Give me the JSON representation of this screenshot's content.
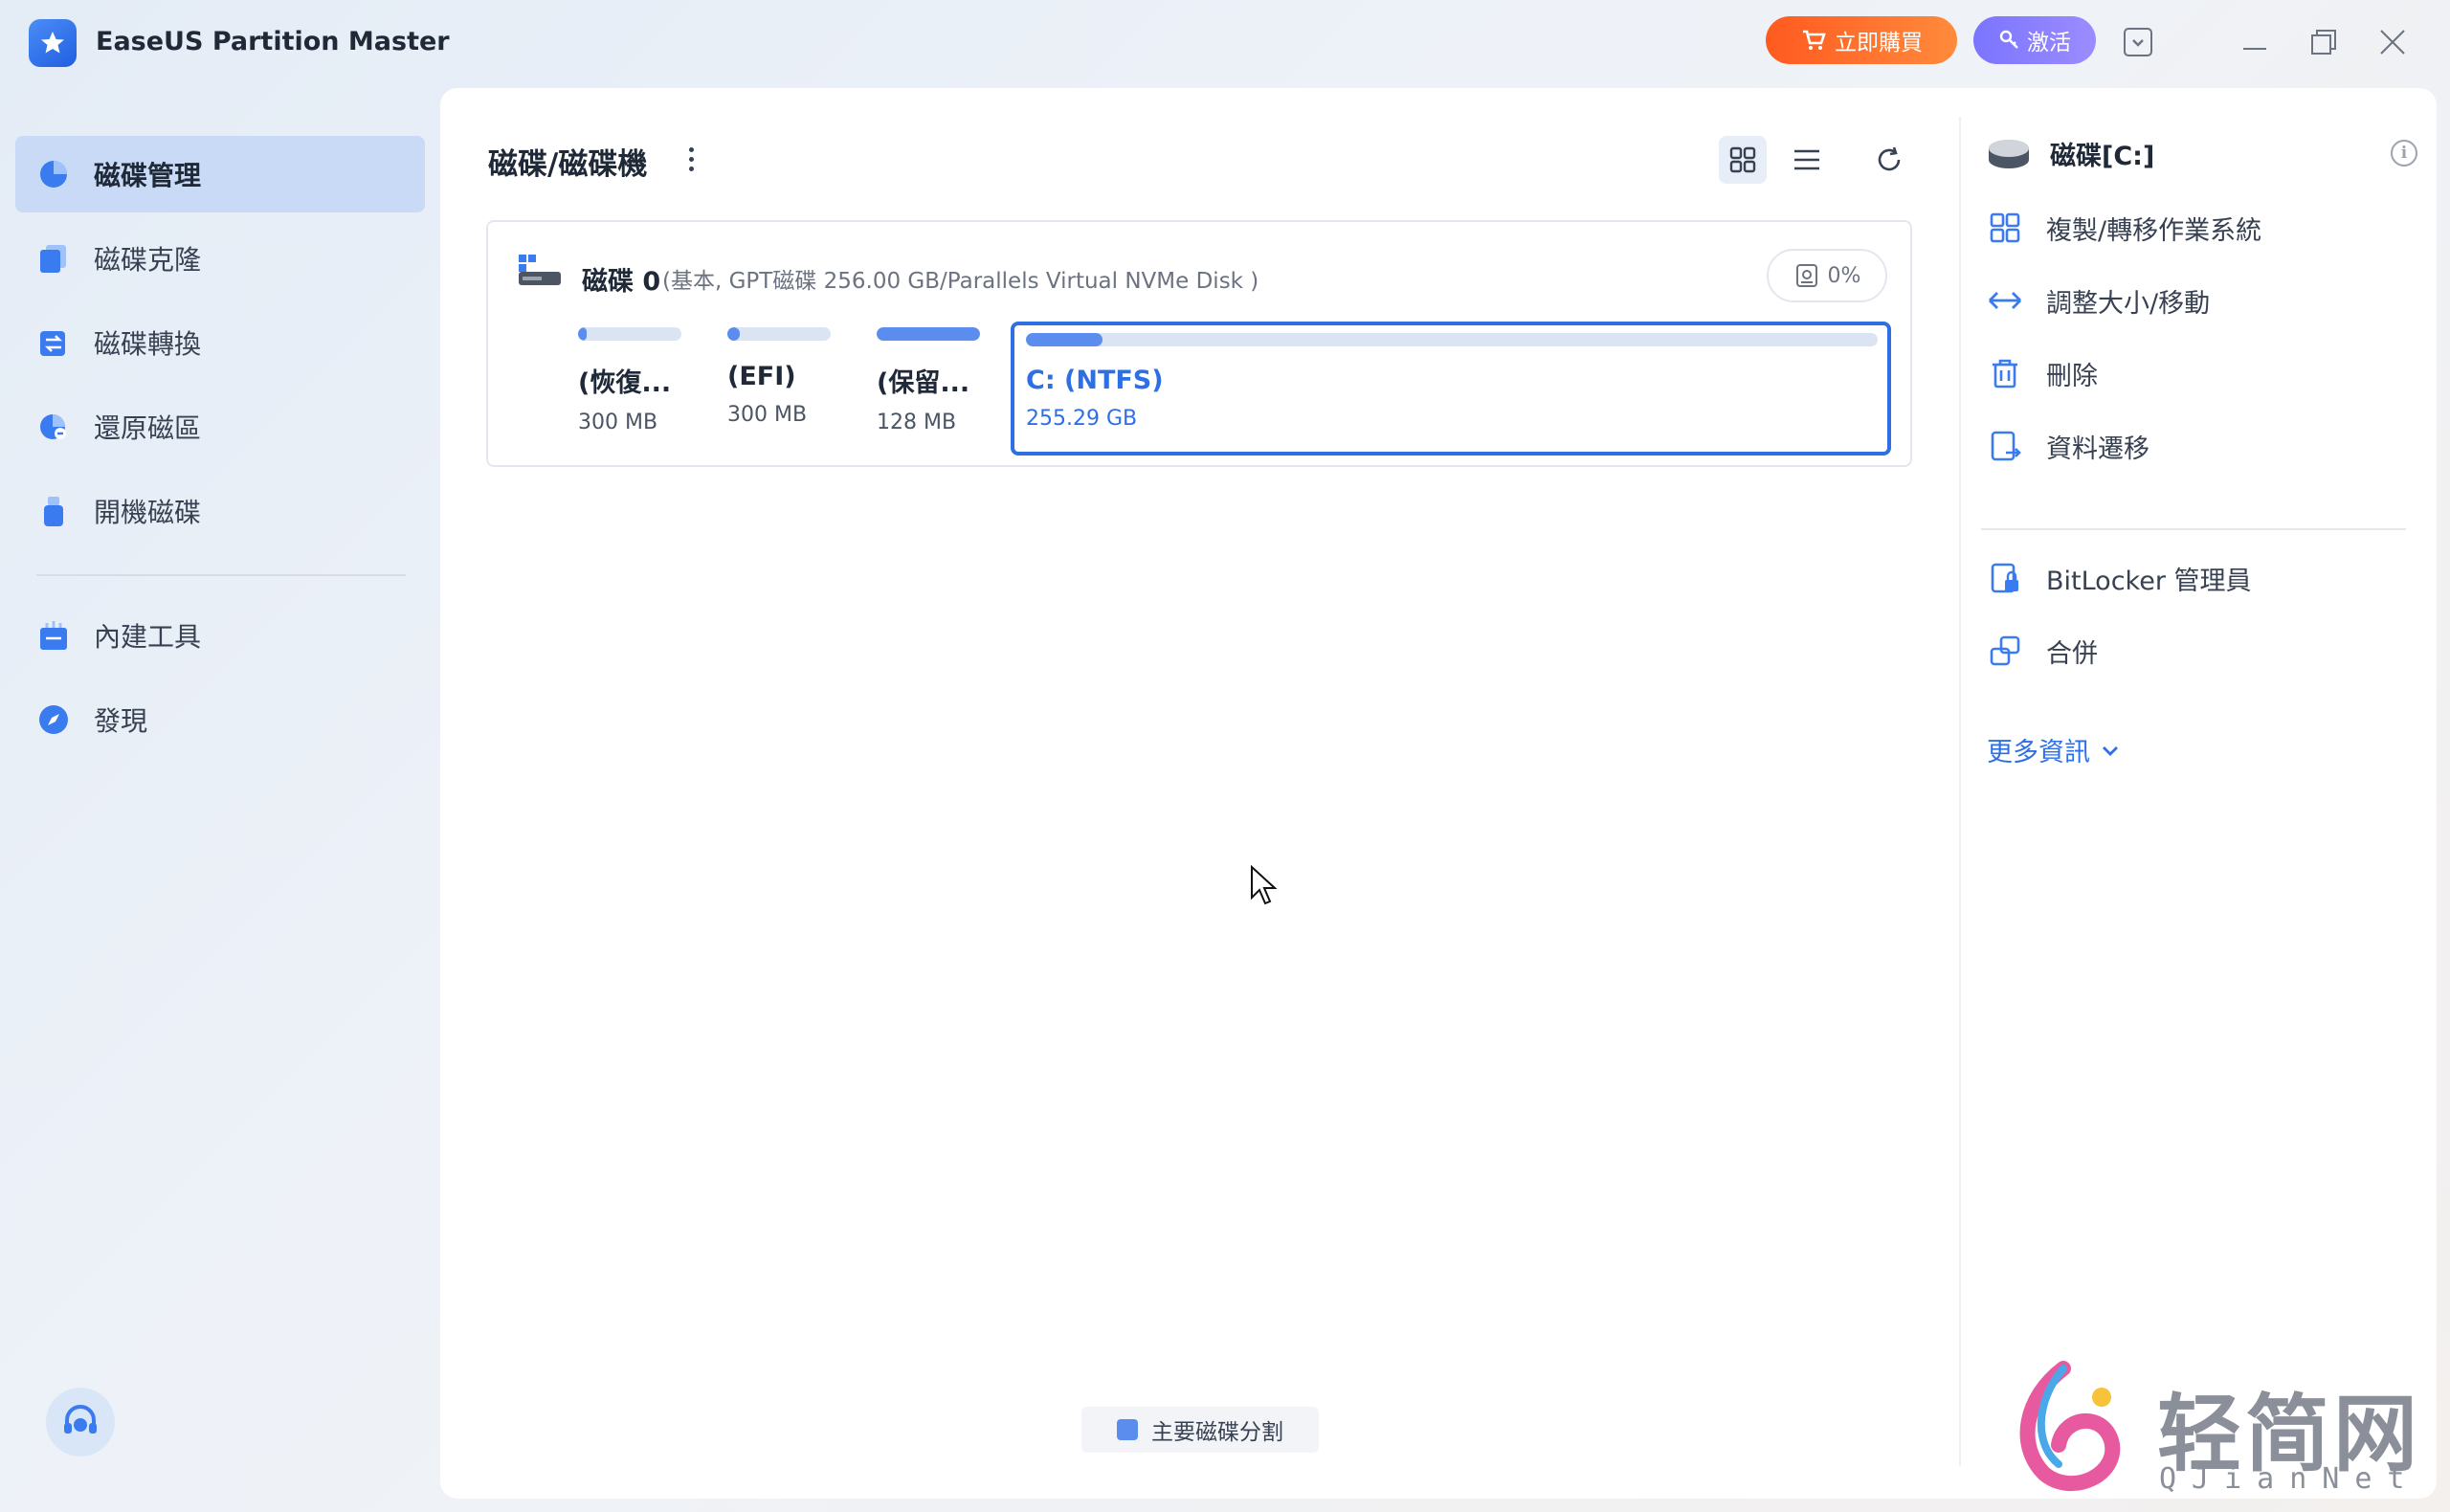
{
  "app": {
    "title": "EaseUS Partition Master",
    "buy_label": "立即購買",
    "activate_label": "激活"
  },
  "sidebar": {
    "items": [
      {
        "label": "磁碟管理",
        "icon": "pie-chart-icon",
        "active": true
      },
      {
        "label": "磁碟克隆",
        "icon": "clone-icon"
      },
      {
        "label": "磁碟轉換",
        "icon": "convert-icon"
      },
      {
        "label": "還原磁區",
        "icon": "recover-icon"
      },
      {
        "label": "開機磁碟",
        "icon": "usb-icon"
      },
      {
        "label": "內建工具",
        "icon": "toolbox-icon"
      },
      {
        "label": "發現",
        "icon": "compass-icon"
      }
    ]
  },
  "main": {
    "title": "磁碟/磁碟機",
    "disk": {
      "name": "磁碟 0",
      "description": "(基本, GPT磁碟 256.00 GB/Parallels Virtual NVMe Disk )",
      "usage": "0%",
      "partitions": [
        {
          "label": "(恢復...",
          "size": "300 MB",
          "fill": 0.08
        },
        {
          "label": "(EFI)",
          "size": "300 MB",
          "fill": 0.12
        },
        {
          "label": "(保留...",
          "size": "128 MB",
          "fill": 1.0
        },
        {
          "label": "C: (NTFS)",
          "size": "255.29 GB",
          "fill": 0.09,
          "selected": true
        }
      ]
    },
    "legend_label": "主要磁碟分割"
  },
  "actions": {
    "title": "磁碟[C:]",
    "items": [
      {
        "label": "複製/轉移作業系統",
        "icon": "migrate-os-icon"
      },
      {
        "label": "調整大小/移動",
        "icon": "resize-icon"
      },
      {
        "label": "刪除",
        "icon": "trash-icon"
      },
      {
        "label": "資料遷移",
        "icon": "data-migrate-icon"
      },
      {
        "label": "BitLocker 管理員",
        "icon": "bitlocker-icon"
      },
      {
        "label": "合併",
        "icon": "merge-icon"
      }
    ],
    "more_label": "更多資訊"
  },
  "watermark": {
    "text": "轻简网",
    "sub": "QJianNet"
  },
  "colors": {
    "accent": "#2f6fe4",
    "buy": "#ff6a2a",
    "activate": "#8b80ff",
    "active_nav": "#c9daf7"
  }
}
